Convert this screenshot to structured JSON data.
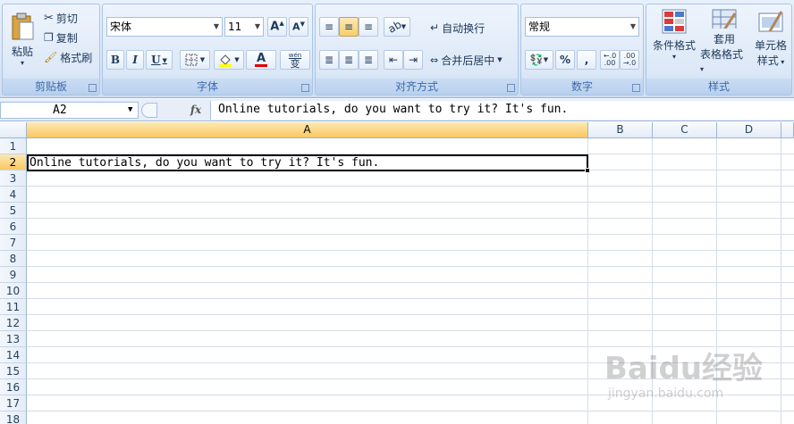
{
  "ribbon": {
    "clipboard": {
      "paste": "粘贴",
      "cut": "剪切",
      "copy": "复制",
      "format_painter": "格式刷",
      "group": "剪贴板"
    },
    "font": {
      "name": "宋体",
      "size": "11",
      "group": "字体",
      "bold": "B",
      "italic": "I",
      "underline": "U",
      "font_color_letter": "A",
      "phonetic": "wén",
      "phonetic_char": "变"
    },
    "alignment": {
      "wrap_text": "自动换行",
      "merge_center": "合并后居中",
      "group": "对齐方式"
    },
    "number": {
      "format": "常规",
      "percent": "%",
      "comma": ",",
      "inc_decimal": ".00",
      "dec_decimal": ".00",
      "group": "数字"
    },
    "styles": {
      "conditional_format": "条件格式",
      "table_format_1": "套用",
      "table_format_2": "表格格式",
      "cell_style_1": "单元格",
      "cell_style_2": "样式",
      "group": "样式"
    }
  },
  "formula_bar": {
    "name_box": "A2",
    "fx": "fx",
    "content": "Online tutorials, do you want to try it? It's fun."
  },
  "sheet": {
    "columns": [
      "A",
      "B",
      "C",
      "D"
    ],
    "rows": [
      "1",
      "2",
      "3",
      "4",
      "5",
      "6",
      "7",
      "8",
      "9",
      "10",
      "11",
      "12",
      "13",
      "14",
      "15",
      "16",
      "17",
      "18"
    ],
    "cell_a2": "Online tutorials, do you want to try it? It's fun."
  },
  "watermark": {
    "brand": "Baidu经验",
    "url": "jingyan.baidu.com"
  },
  "colors": {
    "selected_header": "#f9c862",
    "grid_line": "#d4dde9",
    "ribbon_blue": "#dbe7f6"
  }
}
